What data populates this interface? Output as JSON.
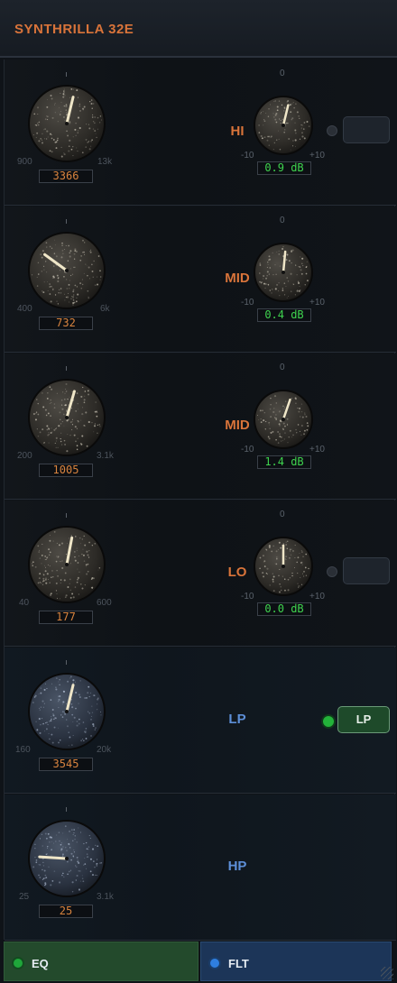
{
  "header": {
    "title": "SYNTHRILLA 32E"
  },
  "bands": [
    {
      "label": "HI",
      "freq_value": "3366",
      "freq_min": "900",
      "freq_max": "13k",
      "freq_level": 0.55,
      "gain_value": "0.9 dB",
      "gain_min": "-10",
      "gain_max": "+10",
      "gain_center": "0",
      "gain_level": 0.55,
      "has_gain": true,
      "toggle": "empty"
    },
    {
      "label": "MID",
      "freq_value": "732",
      "freq_min": "400",
      "freq_max": "6k",
      "freq_level": 0.3,
      "gain_value": "0.4 dB",
      "gain_min": "-10",
      "gain_max": "+10",
      "gain_center": "0",
      "gain_level": 0.52,
      "has_gain": true,
      "toggle": "none"
    },
    {
      "label": "MID",
      "freq_value": "1005",
      "freq_min": "200",
      "freq_max": "3.1k",
      "freq_level": 0.56,
      "gain_value": "1.4 dB",
      "gain_min": "-10",
      "gain_max": "+10",
      "gain_center": "0",
      "gain_level": 0.57,
      "has_gain": true,
      "toggle": "none"
    },
    {
      "label": "LO",
      "freq_value": "177",
      "freq_min": "40",
      "freq_max": "600",
      "freq_level": 0.54,
      "gain_value": "0.0 dB",
      "gain_min": "-10",
      "gain_max": "+10",
      "gain_center": "0",
      "gain_level": 0.5,
      "has_gain": true,
      "toggle": "empty"
    },
    {
      "label": "LP",
      "freq_value": "3545",
      "freq_min": "160",
      "freq_max": "20k",
      "freq_level": 0.55,
      "has_gain": false,
      "toggle": "LP",
      "filter": true
    },
    {
      "label": "HP",
      "freq_value": "25",
      "freq_min": "25",
      "freq_max": "3.1k",
      "freq_level": 0.18,
      "has_gain": false,
      "toggle": "none",
      "filter": true
    }
  ],
  "footer": {
    "eq_label": "EQ",
    "flt_label": "FLT"
  },
  "colors": {
    "accent_orange": "#d9743a",
    "accent_blue": "#5d8fd8",
    "value_green": "#3fd34f",
    "eq_button": "#234a2c",
    "flt_button": "#1c3558"
  }
}
